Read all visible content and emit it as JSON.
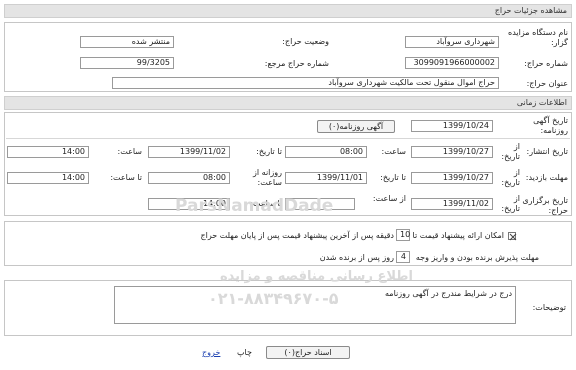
{
  "page": {
    "title": "مشاهده جزئیات حراج"
  },
  "details": {
    "auctioneer_label": "نام دستگاه مزایده گزار:",
    "auctioneer_value": "شهرداری سروآباد",
    "status_label": "وضعیت حراج:",
    "status_value": "منتشر شده",
    "auction_number_label": "شماره حراج:",
    "auction_number_value": "3099091966000002",
    "reference_number_label": "شماره حراج مرجع:",
    "reference_number_value": "99/3205",
    "auction_title_label": "عنوان حراج:",
    "auction_title_value": "حراج اموال منقول تحت مالکیت شهرداری سروآباد"
  },
  "timing": {
    "section_title": "اطلاعات زمانی",
    "ad_date_label": "تاریخ آگهی روزنامه:",
    "ad_date_value": "1399/10/24",
    "newspaper_button": "آگهی روزنامه(۰)",
    "publish_label": "تاریخ انتشار:",
    "visit_label": "مهلت بازدید:",
    "hold_label": "تاریخ برگزاری حراج:",
    "from_date_label": "از تاریخ:",
    "to_date_label": "تا تاریخ:",
    "time_label": "ساعت:",
    "to_time_label": "تا ساعت:",
    "daily_from_label": "روزانه از ساعت:",
    "from_time_label": "از ساعت:",
    "publish_from_date": "1399/10/27",
    "publish_from_time": "08:00",
    "publish_to_date": "1399/11/02",
    "publish_to_time": "14:00",
    "visit_from_date": "1399/10/27",
    "visit_to_date": "1399/11/01",
    "visit_daily_from": "08:00",
    "visit_daily_to": "14:00",
    "hold_date": "1399/11/02",
    "hold_to_time": "14:00",
    "hold_from_time": ""
  },
  "options": {
    "bid_improve_label": "امکان ارائه پیشنهاد قیمت تا",
    "bid_improve_value": "10",
    "bid_improve_suffix": "دقیقه پس از آخرین پیشنهاد قیمت پس از پایان مهلت حراج",
    "winner_deadline_label": "مهلت پذیرش برنده بودن و واریز وجه",
    "winner_deadline_value": "4",
    "winner_deadline_suffix": "روز پس از برنده شدن"
  },
  "notes": {
    "label": "توضیحات:",
    "text": "درج در شرایط مندرج در آگهی روزنامه"
  },
  "footer": {
    "documents_button": "اسناد حراج(۰)",
    "print_label": "چاپ",
    "exit_label": "خروج"
  },
  "watermark": {
    "line1": "ParsNamadDade",
    "line2": "اطلاع رسانی مناقصه و مزایده",
    "line3": "۰۲۱-۸۸۳۴۹۶۷۰-۵"
  }
}
